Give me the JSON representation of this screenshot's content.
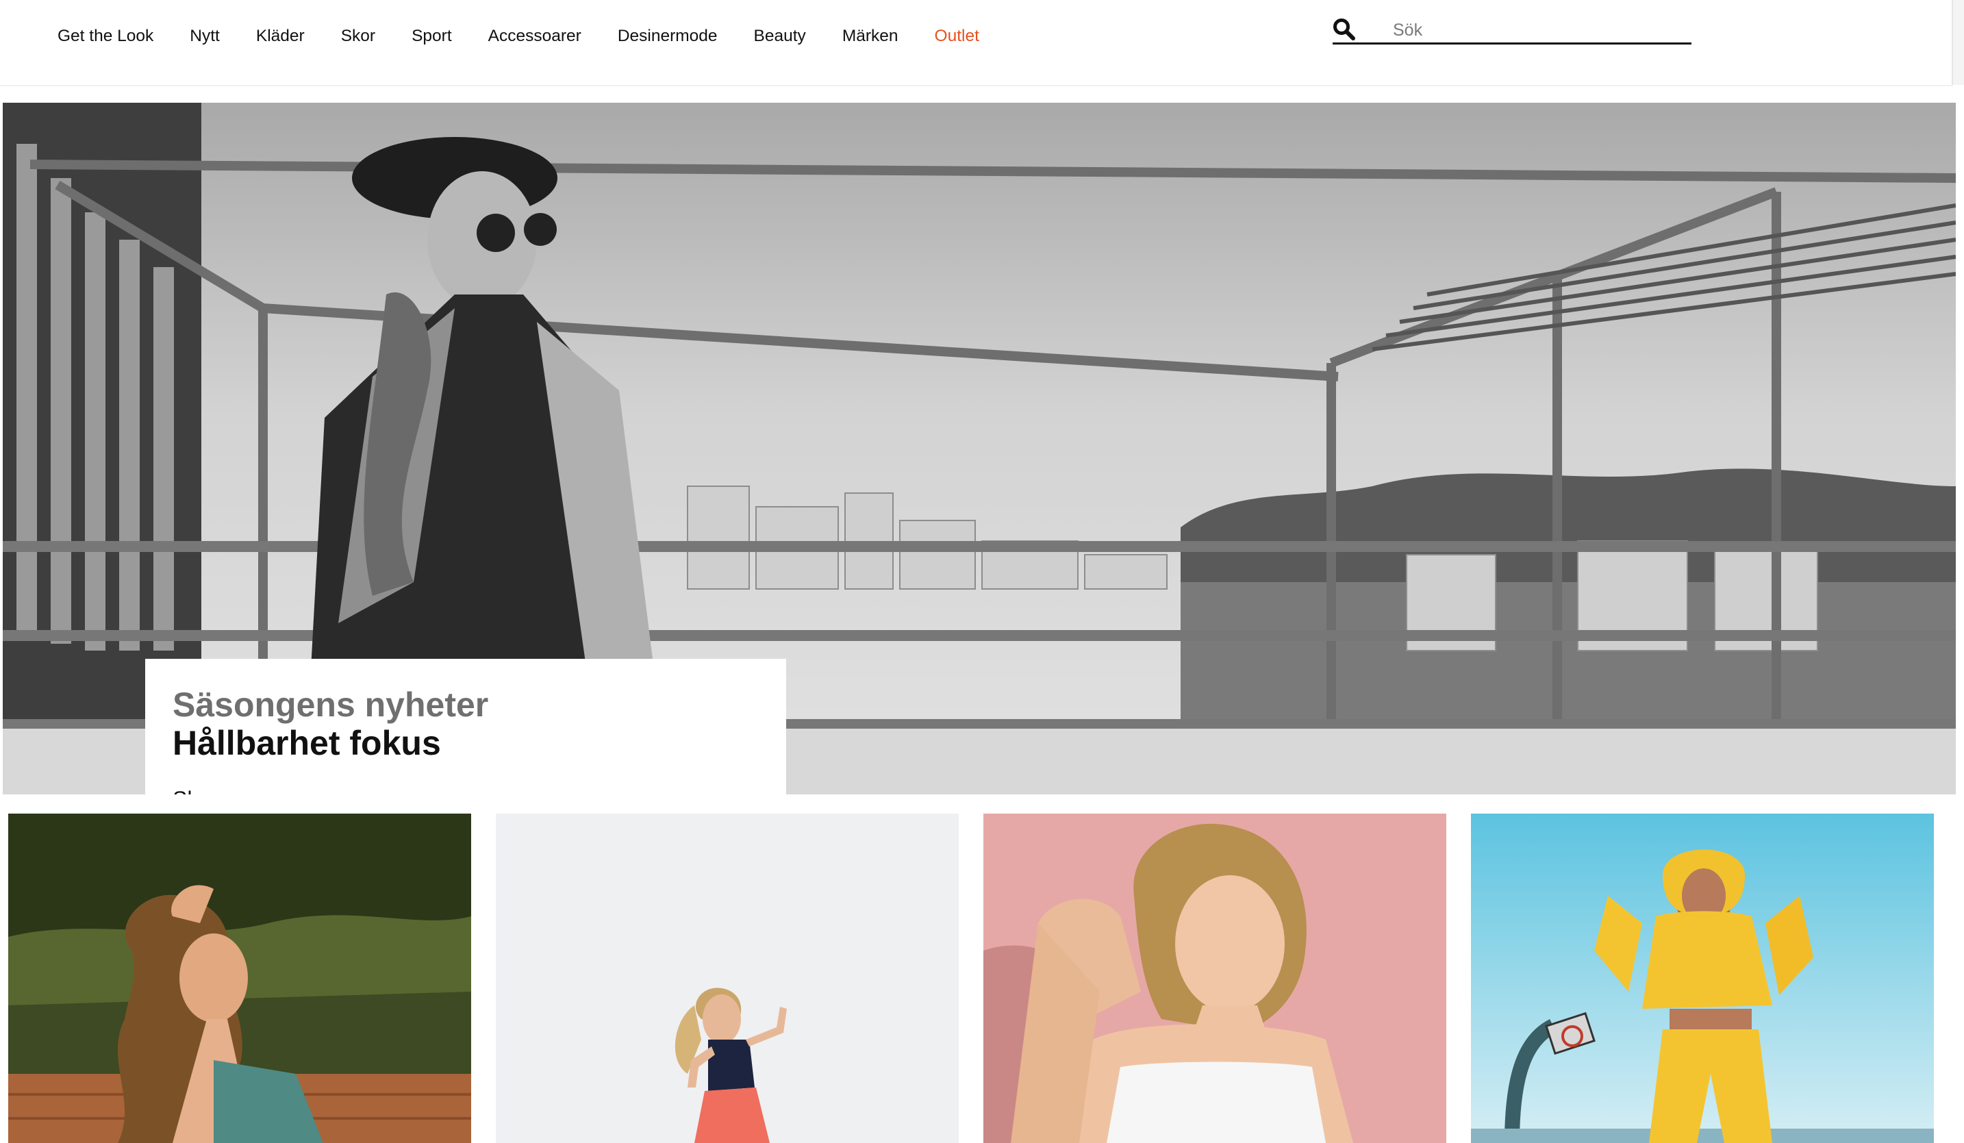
{
  "nav": {
    "items": [
      {
        "label": "Get the Look"
      },
      {
        "label": "Nytt"
      },
      {
        "label": "Kläder"
      },
      {
        "label": "Skor"
      },
      {
        "label": "Sport"
      },
      {
        "label": "Accessoarer"
      },
      {
        "label": "Desinermode"
      },
      {
        "label": "Beauty"
      },
      {
        "label": "Märken"
      },
      {
        "label": "Outlet",
        "color": "#e8501e"
      }
    ]
  },
  "search": {
    "icon": "search-icon",
    "placeholder": "Sök"
  },
  "hero": {
    "subtitle": "Säsongens nyheter",
    "title": "Hållbarhet fokus",
    "cta_label": "Shoppa nu"
  },
  "colors": {
    "accent": "#e8501e",
    "text": "#111111"
  }
}
